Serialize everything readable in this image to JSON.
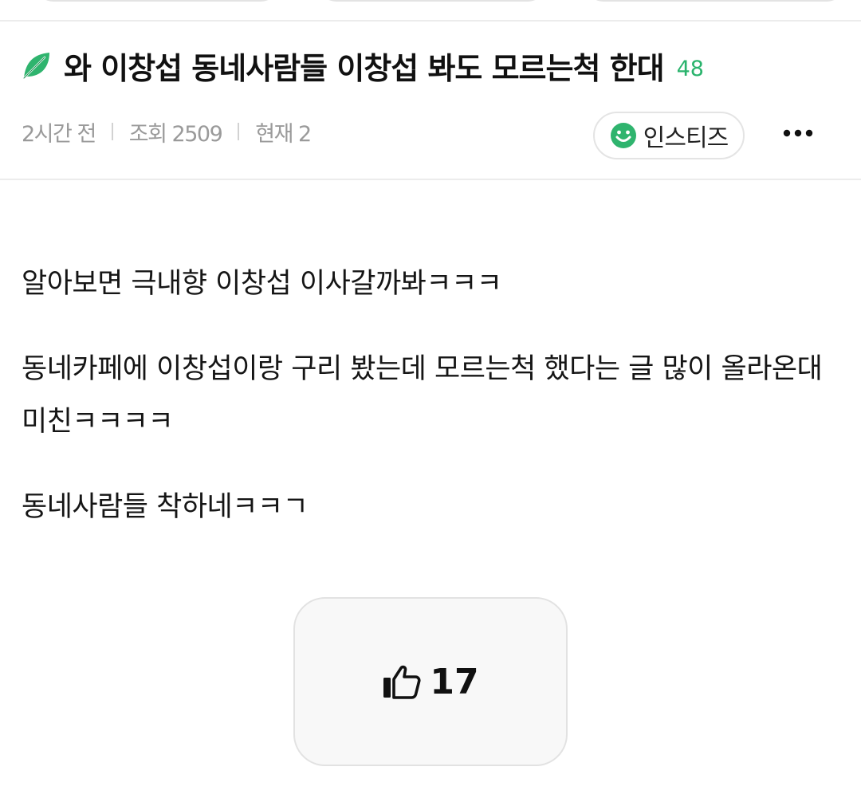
{
  "post": {
    "title": "와 이창섭 동네사람들 이창섭 봐도 모르는척 한대",
    "comment_count": "48",
    "time": "2시간 전",
    "views": "조회 2509",
    "current": "현재 2",
    "community": "인스티즈",
    "body": [
      "알아보면 극내향 이창섭 이사갈까봐ㅋㅋㅋ",
      "동네카페에 이창섭이랑 구리 봤는데 모르는척 했다는 글 많이 올라온대 미친ㅋㅋㅋㅋ",
      "동네사람들 착하네ㅋㅋㄱ"
    ],
    "like_count": "17"
  },
  "icons": {
    "title_icon": "leaf-icon",
    "community_icon": "smile-icon",
    "menu_icon": "more-icon",
    "like_icon": "thumbs-up-icon"
  },
  "colors": {
    "accent_green": "#29b36c",
    "meta_gray": "#9a9a9a"
  }
}
